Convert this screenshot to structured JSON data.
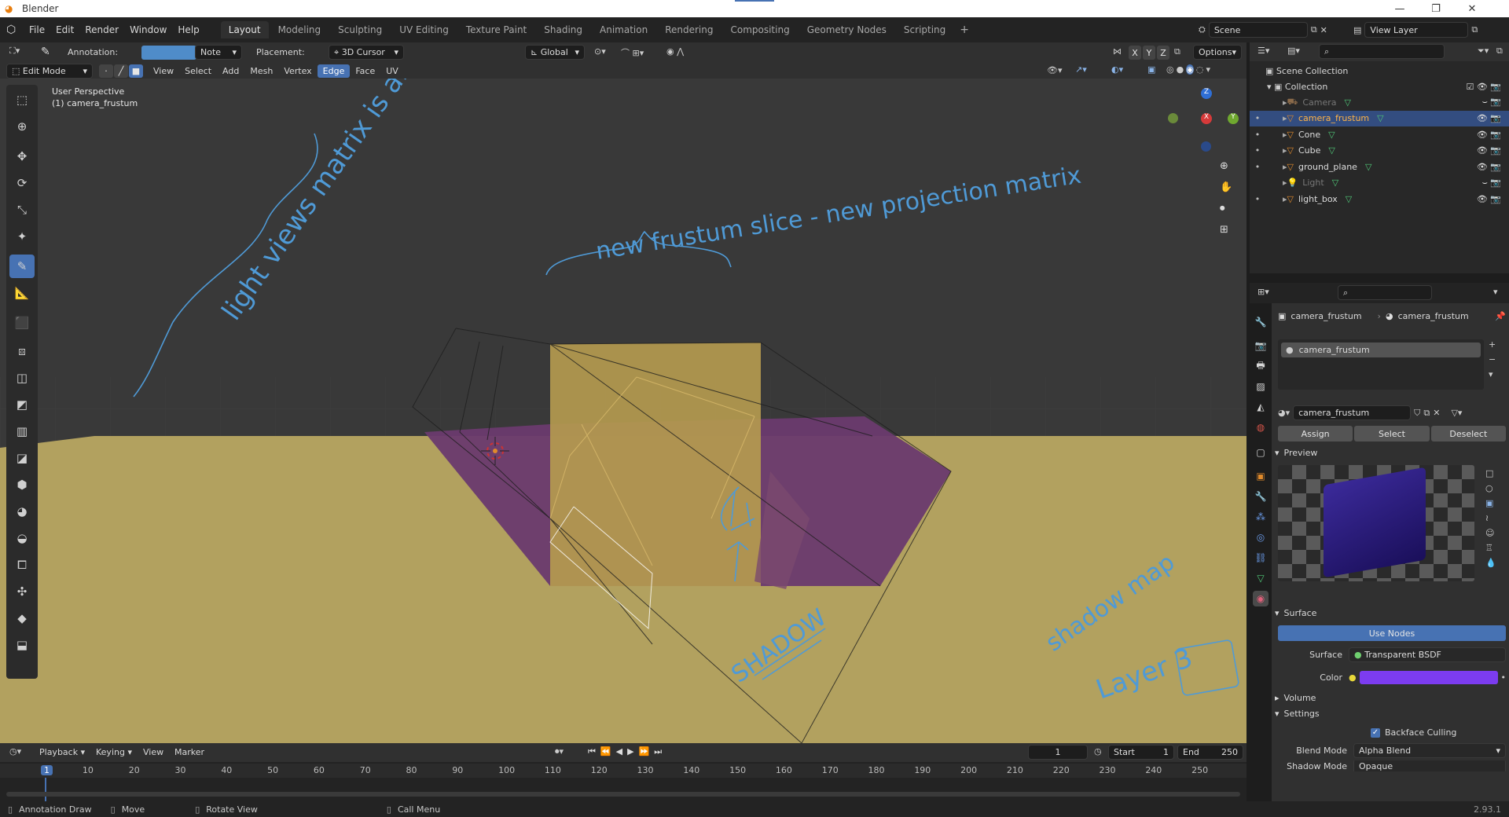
{
  "window": {
    "title": "Blender",
    "minimize": "—",
    "restore": "❐",
    "close": "✕"
  },
  "menu": [
    "File",
    "Edit",
    "Render",
    "Window",
    "Help"
  ],
  "workspaces": [
    "Layout",
    "Modeling",
    "Sculpting",
    "UV Editing",
    "Texture Paint",
    "Shading",
    "Animation",
    "Rendering",
    "Compositing",
    "Geometry Nodes",
    "Scripting"
  ],
  "scene": {
    "name": "Scene",
    "view_layer": "View Layer"
  },
  "tool_header": {
    "annotation_label": "Annotation:",
    "note": "Note",
    "placement_label": "Placement:",
    "placement": "3D Cursor",
    "orientation": "Global",
    "axes": [
      "X",
      "Y",
      "Z"
    ],
    "options": "Options"
  },
  "viewport_header": {
    "mode": "Edit Mode",
    "menus": [
      "View",
      "Select",
      "Add",
      "Mesh",
      "Vertex",
      "Edge",
      "Face",
      "UV"
    ],
    "active_menu": "Edge"
  },
  "viewport": {
    "perspective": "User Perspective",
    "object": "(1) camera_frustum",
    "colors": {
      "ground": "#b2a15f",
      "purple": "#6a3a6e",
      "frustum_face": "#b49a4f",
      "sky": "#393939",
      "annotation": "#4f9ad6"
    }
  },
  "annotations": [
    "light views matrix is all same",
    "new frustum slice - new projection matrix",
    "SHADOW",
    "shadow map",
    "Layer 3"
  ],
  "outliner": {
    "root": "Scene Collection",
    "collection": "Collection",
    "items": [
      {
        "name": "Camera",
        "muted": true
      },
      {
        "name": "camera_frustum",
        "selected": true
      },
      {
        "name": "Cone"
      },
      {
        "name": "Cube"
      },
      {
        "name": "ground_plane"
      },
      {
        "name": "Light",
        "muted": true
      },
      {
        "name": "light_box"
      }
    ]
  },
  "properties": {
    "object": "camera_frustum",
    "material": "camera_frustum",
    "slot": "camera_frustum",
    "datablock": "camera_frustum",
    "assign": "Assign",
    "select": "Select",
    "deselect": "Deselect",
    "preview": "Preview",
    "surface": "Surface",
    "use_nodes": "Use Nodes",
    "surface_label": "Surface",
    "surface_value": "Transparent BSDF",
    "color_label": "Color",
    "color_value": "#7c3cf0",
    "volume": "Volume",
    "settings": "Settings",
    "backface": "Backface Culling",
    "blend_mode_label": "Blend Mode",
    "blend_mode": "Alpha Blend",
    "shadow_mode_label": "Shadow Mode",
    "shadow_mode": "Opaque"
  },
  "timeline": {
    "playback": "Playback",
    "keying": "Keying",
    "view": "View",
    "marker": "Marker",
    "current_frame": "1",
    "start_label": "Start",
    "start": "1",
    "end_label": "End",
    "end": "250",
    "ruler": [
      "1",
      "10",
      "20",
      "30",
      "40",
      "50",
      "60",
      "70",
      "80",
      "90",
      "100",
      "110",
      "120",
      "130",
      "140",
      "150",
      "160",
      "170",
      "180",
      "190",
      "200",
      "210",
      "220",
      "230",
      "240",
      "250"
    ]
  },
  "status": {
    "item1": "Annotation Draw",
    "item2": "Move",
    "item3": "Rotate View",
    "item4": "Call Menu",
    "version": "2.93.1"
  }
}
